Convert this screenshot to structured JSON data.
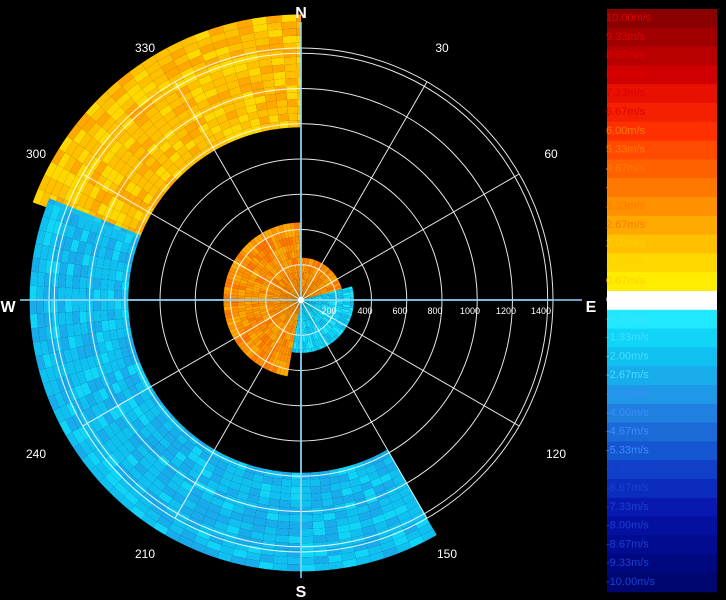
{
  "chart_data": {
    "type": "polar-velocity-scan",
    "compass": {
      "north": "N",
      "east": "E",
      "south": "S",
      "west": "W"
    },
    "angle_labels": [
      "30",
      "60",
      "120",
      "150",
      "210",
      "240",
      "300",
      "330"
    ],
    "angle_values": [
      30,
      60,
      120,
      150,
      210,
      240,
      300,
      330
    ],
    "range_labels": [
      "200",
      "400",
      "600",
      "800",
      "1000",
      "1200",
      "1400"
    ],
    "range_values": [
      200,
      400,
      600,
      800,
      1000,
      1200,
      1400
    ],
    "range_max": 1700,
    "colorbar": {
      "labels": [
        "10.00m/s",
        "9.33m/s",
        "8.67m/s",
        "8.00m/s",
        "7.33m/s",
        "6.67m/s",
        "6.00m/s",
        "5.33m/s",
        "4.67m/s",
        "4.00m/s",
        "3.33m/s",
        "2.67m/s",
        "2.00m/s",
        "1.33m/s",
        "0.67m/s",
        "0.00m/s",
        "-0.67m/s",
        "-1.33m/s",
        "-2.00m/s",
        "-2.67m/s",
        "-3.33m/s",
        "-4.00m/s",
        "-4.67m/s",
        "-5.33m/s",
        "-6.00m/s",
        "-6.67m/s",
        "-7.33m/s",
        "-8.00m/s",
        "-8.67m/s",
        "-9.33m/s",
        "-10.00m/s"
      ],
      "values": [
        10,
        9.33,
        8.67,
        8,
        7.33,
        6.67,
        6,
        5.33,
        4.67,
        4,
        3.33,
        2.67,
        2,
        1.33,
        0.67,
        0,
        -0.67,
        -1.33,
        -2,
        -2.67,
        -3.33,
        -4,
        -4.67,
        -5.33,
        -6,
        -6.67,
        -7.33,
        -8,
        -8.67,
        -9.33,
        -10
      ],
      "colors": [
        "#8b0000",
        "#a00000",
        "#b80000",
        "#d00000",
        "#e81000",
        "#f52000",
        "#ff3000",
        "#ff4a00",
        "#ff6000",
        "#ff7800",
        "#ff9000",
        "#ffa800",
        "#ffc000",
        "#ffd800",
        "#ffec00",
        "#ffffff",
        "#20e8ff",
        "#10d4f8",
        "#10c0f0",
        "#18acec",
        "#2098e8",
        "#2080e0",
        "#1a6ad8",
        "#1456d0",
        "#1040c8",
        "#0c2cc0",
        "#0818b0",
        "#0410a0",
        "#020c90",
        "#000880",
        "#000670"
      ]
    },
    "regions": [
      {
        "name": "positive-inner",
        "from_deg": 190,
        "to_deg": 360,
        "r_min": 0,
        "r_max": 440,
        "value": 3.3
      },
      {
        "name": "positive-inner-east",
        "from_deg": 0,
        "to_deg": 75,
        "r_min": 0,
        "r_max": 240,
        "value": 3.3
      },
      {
        "name": "negative-inner",
        "from_deg": 75,
        "to_deg": 190,
        "r_min": 0,
        "r_max": 300,
        "value": -1.4
      },
      {
        "name": "positive-outer",
        "from_deg": 290,
        "to_deg": 360,
        "r_min": 980,
        "r_max": 1620,
        "value": 2.0
      },
      {
        "name": "negative-outer",
        "from_deg": 150,
        "to_deg": 292,
        "r_min": 980,
        "r_max": 1540,
        "value": -2.1
      }
    ]
  }
}
